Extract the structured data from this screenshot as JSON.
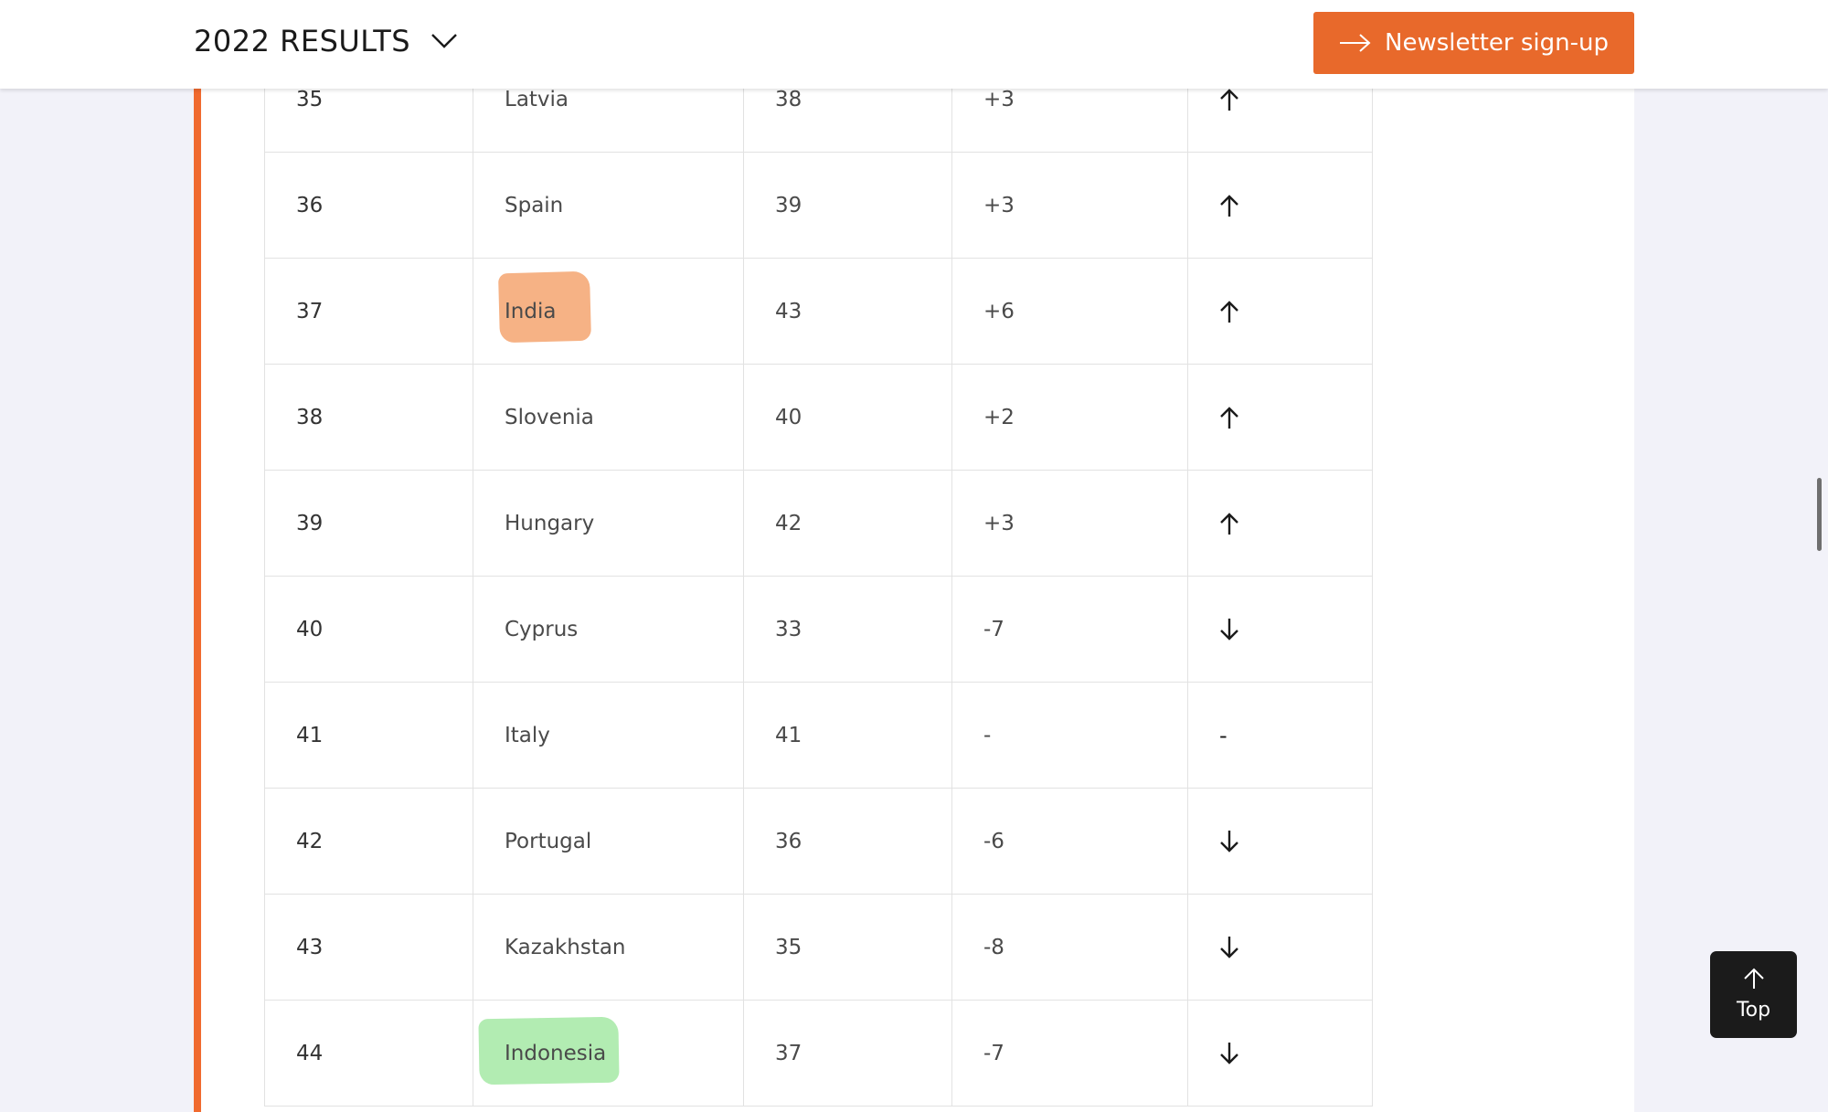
{
  "header": {
    "results_title": "2022 RESULTS",
    "newsletter_label": "Newsletter sign-up"
  },
  "rows": [
    {
      "rank": "35",
      "country": "Latvia",
      "previous": "38",
      "change": "+3",
      "trend": "up",
      "highlight": ""
    },
    {
      "rank": "36",
      "country": "Spain",
      "previous": "39",
      "change": "+3",
      "trend": "up",
      "highlight": ""
    },
    {
      "rank": "37",
      "country": "India",
      "previous": "43",
      "change": "+6",
      "trend": "up",
      "highlight": "orange"
    },
    {
      "rank": "38",
      "country": "Slovenia",
      "previous": "40",
      "change": "+2",
      "trend": "up",
      "highlight": ""
    },
    {
      "rank": "39",
      "country": "Hungary",
      "previous": "42",
      "change": "+3",
      "trend": "up",
      "highlight": ""
    },
    {
      "rank": "40",
      "country": "Cyprus",
      "previous": "33",
      "change": "-7",
      "trend": "down",
      "highlight": ""
    },
    {
      "rank": "41",
      "country": "Italy",
      "previous": "41",
      "change": "-",
      "trend": "same",
      "highlight": ""
    },
    {
      "rank": "42",
      "country": "Portugal",
      "previous": "36",
      "change": "-6",
      "trend": "down",
      "highlight": ""
    },
    {
      "rank": "43",
      "country": "Kazakhstan",
      "previous": "35",
      "change": "-8",
      "trend": "down",
      "highlight": ""
    },
    {
      "rank": "44",
      "country": "Indonesia",
      "previous": "37",
      "change": "-7",
      "trend": "down",
      "highlight": "green"
    }
  ],
  "trend_icons": {
    "up": "arrow-up-icon",
    "down": "arrow-down-icon",
    "same": "-"
  },
  "top_button": {
    "label": "Top"
  },
  "colors": {
    "accent": "#e8692b",
    "highlight_orange": "#f4a470",
    "highlight_green": "#98e698"
  }
}
